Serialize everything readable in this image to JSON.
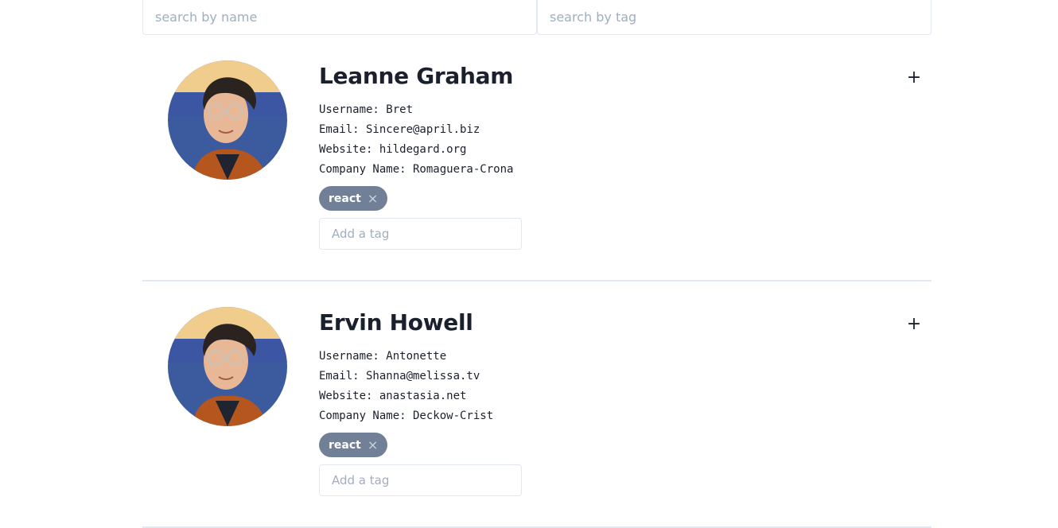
{
  "search": {
    "name_placeholder": "search by name",
    "tag_placeholder": "search by tag"
  },
  "students": [
    {
      "name": "Leanne Graham",
      "details": [
        "Username: Bret",
        "Email: Sincere@april.biz",
        "Website: hildegard.org",
        "Company Name: Romaguera-Crona"
      ],
      "tags": [
        {
          "label": "react",
          "remove_icon": "×"
        }
      ],
      "tag_input_placeholder": "Add a tag",
      "expand_label": "+"
    },
    {
      "name": "Ervin Howell",
      "details": [
        "Username: Antonette",
        "Email: Shanna@melissa.tv",
        "Website: anastasia.net",
        "Company Name: Deckow-Crist"
      ],
      "tags": [
        {
          "label": "react",
          "remove_icon": "×"
        }
      ],
      "tag_input_placeholder": "Add a tag",
      "expand_label": "+"
    }
  ],
  "colors": {
    "tag_background": "#718096",
    "border": "#e2e8f0",
    "text": "#1a202c",
    "placeholder": "#a0aec0"
  }
}
